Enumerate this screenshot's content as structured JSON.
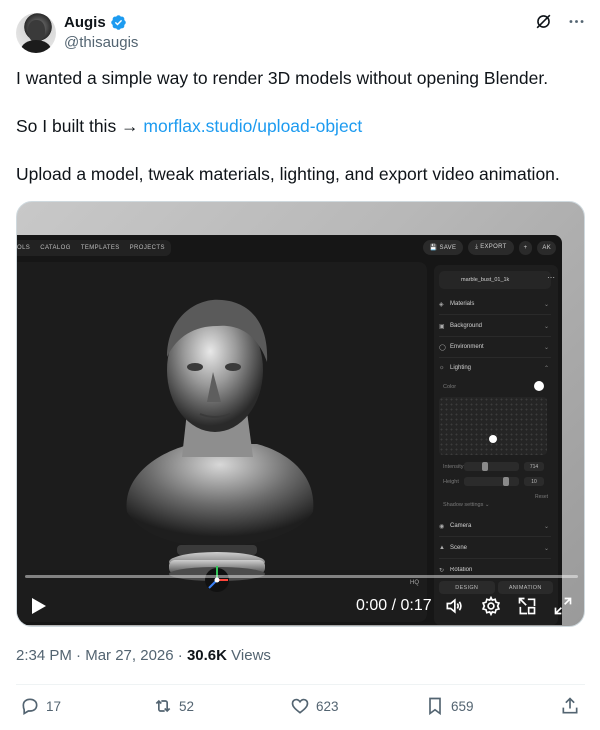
{
  "author": {
    "display_name": "Augis",
    "handle": "@thisaugis"
  },
  "tweet": {
    "line1": "I wanted a simple way to render 3D models without opening Blender.",
    "line2_prefix": "So I built this → ",
    "line2_link": "morflax.studio/upload-object",
    "line3": "Upload a model, tweak materials, lighting, and export video animation."
  },
  "app": {
    "nav": [
      "OLS",
      "CATALOG",
      "TEMPLATES",
      "PROJECTS"
    ],
    "save_label": "SAVE",
    "export_label": "EXPORT",
    "plus_label": "+",
    "avatar_initials": "AK",
    "file_name": "marble_bust_01_1k",
    "sections": [
      "Materials",
      "Background",
      "Environment",
      "Lighting"
    ],
    "color_label": "Color",
    "intensity_label": "Intensity",
    "intensity_value": "714",
    "height_label": "Height",
    "height_value": "10",
    "reset_label": "Reset",
    "shadow_label": "Shadow settings",
    "lower_sections": [
      "Camera",
      "Scene",
      "Rotation"
    ],
    "tabs": [
      "DESIGN",
      "ANIMATION"
    ],
    "hq_label": "HQ"
  },
  "video": {
    "time": "0:00 / 0:17"
  },
  "meta": {
    "time": "2:34 PM",
    "date": "Mar 27, 2026",
    "views_count": "30.6K",
    "views_label": "Views"
  },
  "actions": {
    "replies": "17",
    "reposts": "52",
    "likes": "623",
    "bookmarks": "659"
  },
  "colors": {
    "link": "#1d9bf0",
    "verified": "#1d9bf0",
    "muted": "#536471"
  }
}
